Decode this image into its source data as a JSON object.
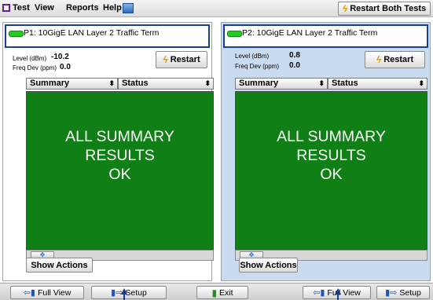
{
  "menubar": {
    "items": [
      "Test",
      "View",
      "Reports",
      "Help"
    ],
    "restart_both": "Restart Both Tests"
  },
  "panes": [
    {
      "port_title": "P1: 10GigE LAN Layer 2 Traffic Term",
      "level_label": "Level (dBm)",
      "level_value": "-10.2",
      "freq_label": "Freq Dev (ppm)",
      "freq_value": "0.0",
      "restart_label": "Restart",
      "summary_select": "Summary",
      "status_select": "Status",
      "result_lines": [
        "ALL SUMMARY",
        "RESULTS",
        "OK"
      ],
      "show_actions": "Show Actions"
    },
    {
      "port_title": "P2: 10GigE LAN Layer 2 Traffic Term",
      "level_label": "Level (dBm)",
      "level_value": "0.8",
      "freq_label": "Freq Dev (ppm)",
      "freq_value": "0.0",
      "restart_label": "Restart",
      "summary_select": "Summary",
      "status_select": "Status",
      "result_lines": [
        "ALL SUMMARY",
        "RESULTS",
        "OK"
      ],
      "show_actions": "Show Actions"
    }
  ],
  "bottom": {
    "full_view_left": "Full View",
    "setup_left": "Setup",
    "exit": "Exit",
    "full_view_right": "Full View",
    "setup_right": "Setup"
  },
  "colors": {
    "result_bg": "#0f7f16",
    "p2_bg": "#c9dcef",
    "title_border": "#1a3f8f"
  },
  "icons": [
    "test-icon",
    "help-icon",
    "lightning-icon",
    "led-icon",
    "arrow-left-icon",
    "arrow-right-icon",
    "exit-icon",
    "navigation-icon"
  ]
}
